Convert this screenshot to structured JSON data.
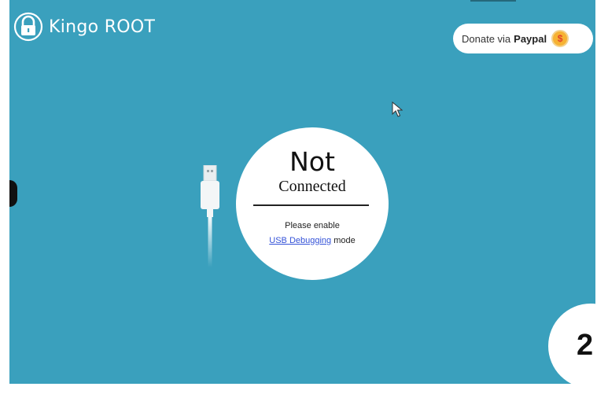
{
  "header": {
    "brand_name": "Kingo ROOT"
  },
  "donate": {
    "label": "Donate via",
    "brand": "Paypal",
    "coin_symbol": "$"
  },
  "status": {
    "title": "Not",
    "subtitle": "Connected",
    "hint_line1": "Please enable",
    "hint_link": "USB Debugging",
    "hint_suffix": " mode"
  },
  "step_badge": {
    "number": "2"
  },
  "icons": {
    "brand": "padlock-icon",
    "cursor": "mouse-pointer-icon",
    "usb": "usb-cable-icon",
    "coin": "dollar-coin-icon"
  },
  "colors": {
    "background": "#3aa0bd",
    "link": "#3452d8",
    "coin": "#f6b233"
  }
}
